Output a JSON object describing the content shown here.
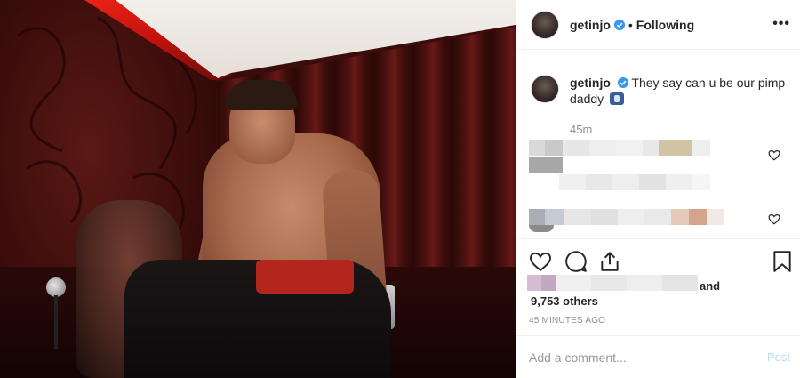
{
  "post": {
    "username": "getinjo",
    "follow_separator": "•",
    "follow_status": "Following",
    "more_label": "•••",
    "caption_text": "They say can u be our pimp daddy",
    "caption_emoji": "mobile-phone-emoji",
    "caption_age": "45m",
    "likes_and": "and",
    "likes_others": "9,753 others",
    "posted_time": "45 MINUTES AGO",
    "comment_placeholder": "Add a comment...",
    "post_button": "Post"
  },
  "colors": {
    "verified_blue": "#3897f0",
    "post_button_disabled": "#b3dbff",
    "border": "#efefef",
    "secondary_text": "#8e8e8e"
  },
  "icons": [
    "verified-badge-icon",
    "more-options-icon",
    "heart-icon",
    "comment-icon",
    "share-icon",
    "bookmark-icon"
  ]
}
